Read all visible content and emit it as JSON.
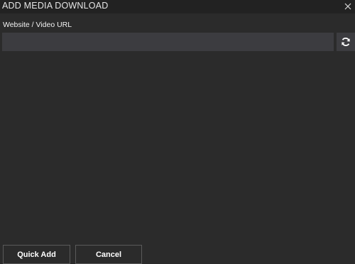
{
  "window": {
    "title": "ADD MEDIA DOWNLOAD",
    "close_icon": "close-icon"
  },
  "form": {
    "url_label": "Website / Video URL",
    "url_value": "",
    "url_placeholder": "",
    "refresh_icon": "refresh-icon"
  },
  "actions": {
    "quick_add_label": "Quick Add",
    "cancel_label": "Cancel"
  },
  "colors": {
    "background": "#2b2b2b",
    "titlebar": "#222222",
    "input_background": "#3c3c40",
    "button_border": "#5a5a5a",
    "text": "#ffffff"
  }
}
